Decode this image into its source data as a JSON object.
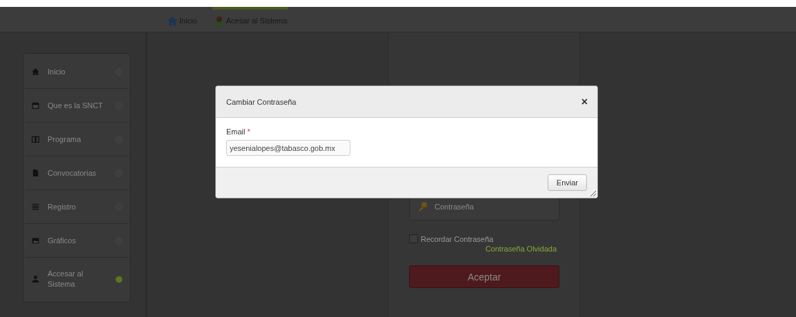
{
  "top_nav": [
    {
      "label": "Inicio",
      "selected": false
    },
    {
      "label": "Acesar al Sistema",
      "selected": true
    }
  ],
  "sidebar": {
    "items": [
      {
        "label": "Inicio",
        "selected": false
      },
      {
        "label": "Que es la SNCT",
        "selected": false
      },
      {
        "label": "Programa",
        "selected": false
      },
      {
        "label": "Convocatorias",
        "selected": false
      },
      {
        "label": "Registro",
        "selected": false
      },
      {
        "label": "Gráficos",
        "selected": false
      },
      {
        "label": "Accesar al Sistema",
        "selected": true
      }
    ]
  },
  "login": {
    "password": {
      "placeholder": "Contraseña"
    },
    "remember": {
      "label": "Recordar Contraseña",
      "checked": false
    },
    "forgot_link": "Contraseña Olvidada",
    "submit": "Aceptar"
  },
  "dialog": {
    "title": "Cambiar Contraseña",
    "close": "×",
    "field": {
      "label": "Email",
      "required_mark": "*",
      "value": "yesenialopes@tabasco.gob.mx"
    },
    "button": "Enviar"
  }
}
